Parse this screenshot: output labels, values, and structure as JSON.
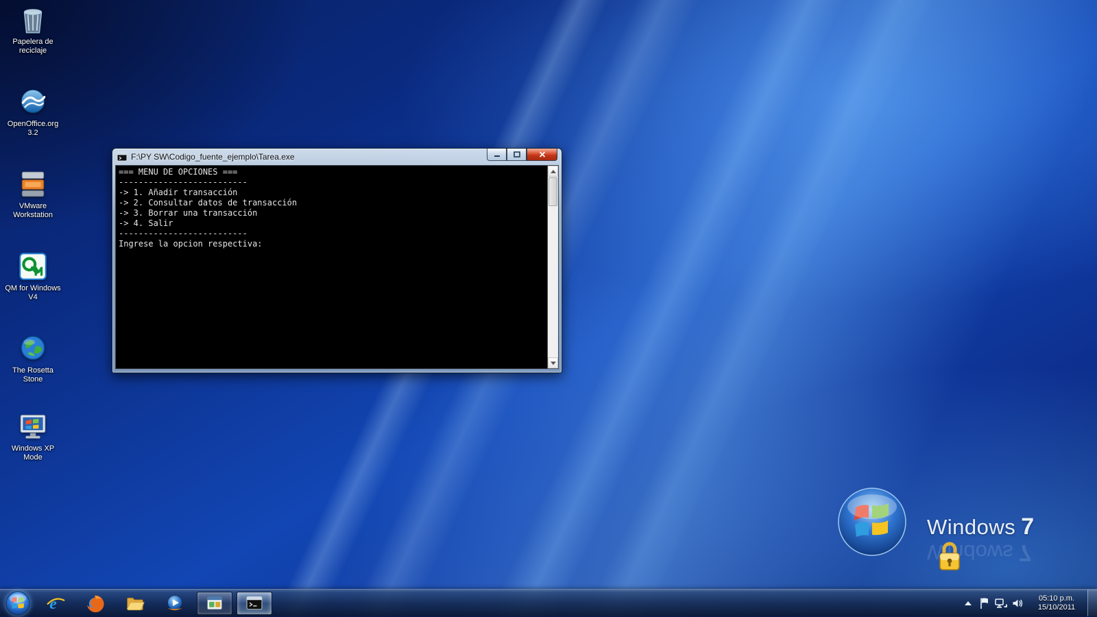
{
  "desktop": {
    "icons": [
      {
        "id": "recycle-bin",
        "label": "Papelera de reciclaje"
      },
      {
        "id": "openoffice",
        "label": "OpenOffice.org 3.2"
      },
      {
        "id": "vmware-workstation",
        "label": "VMware Workstation"
      },
      {
        "id": "qm-for-windows",
        "label": "QM for Windows V4"
      },
      {
        "id": "rosetta-stone",
        "label": "The Rosetta Stone"
      },
      {
        "id": "windows-xp-mode",
        "label": "Windows XP Mode"
      }
    ],
    "watermark": {
      "brand": "Windows",
      "edition": "7"
    }
  },
  "console": {
    "title": "F:\\PY SW\\Codigo_fuente_ejemplo\\Tarea.exe",
    "window_buttons": [
      "minimize",
      "maximize",
      "close"
    ],
    "lines": [
      "=== MENU DE OPCIONES ===",
      "--------------------------",
      "-> 1. Añadir transacción",
      "-> 2. Consultar datos de transacción",
      "-> 3. Borrar una transacción",
      "-> 4. Salir",
      "--------------------------",
      "Ingrese la opcion respectiva:"
    ]
  },
  "taskbar": {
    "apps": [
      {
        "icon": "internet-explorer-icon"
      },
      {
        "icon": "firefox-icon"
      },
      {
        "icon": "explorer-folder-icon"
      },
      {
        "icon": "media-player-icon"
      },
      {
        "icon": "app-window-icon",
        "state": "running"
      },
      {
        "icon": "console-app-icon",
        "state": "active"
      }
    ],
    "tray_icons": [
      "hidden-icons-arrow",
      "action-center-flag",
      "network-icon",
      "volume-icon"
    ],
    "clock": {
      "time": "05:10 p.m.",
      "date": "15/10/2011"
    }
  }
}
